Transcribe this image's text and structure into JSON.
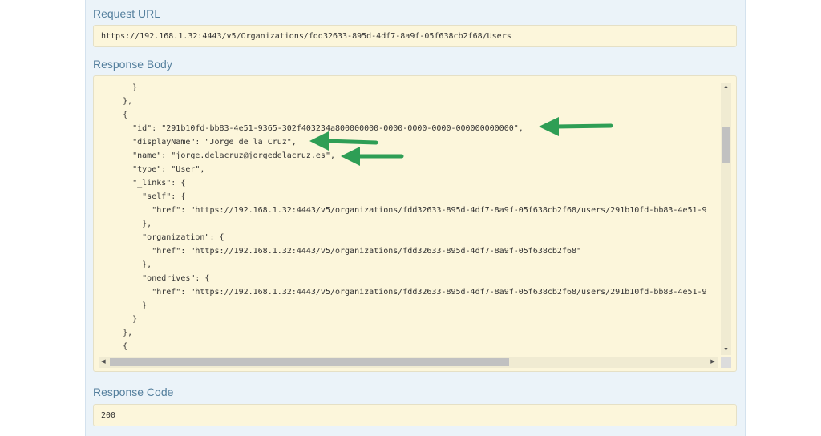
{
  "request_url": {
    "title": "Request URL",
    "value": "https://192.168.1.32:4443/v5/Organizations/fdd32633-895d-4df7-8a9f-05f638cb2f68/Users"
  },
  "response_body": {
    "title": "Response Body",
    "lines": [
      "      }",
      "    },",
      "    {",
      "      \"id\": \"291b10fd-bb83-4e51-9365-302f403234a800000000-0000-0000-0000-000000000000\",",
      "      \"displayName\": \"Jorge de la Cruz\",",
      "      \"name\": \"jorge.delacruz@jorgedelacruz.es\",",
      "      \"type\": \"User\",",
      "      \"_links\": {",
      "        \"self\": {",
      "          \"href\": \"https://192.168.1.32:4443/v5/organizations/fdd32633-895d-4df7-8a9f-05f638cb2f68/users/291b10fd-bb83-4e51-9",
      "        },",
      "        \"organization\": {",
      "          \"href\": \"https://192.168.1.32:4443/v5/organizations/fdd32633-895d-4df7-8a9f-05f638cb2f68\"",
      "        },",
      "        \"onedrives\": {",
      "          \"href\": \"https://192.168.1.32:4443/v5/organizations/fdd32633-895d-4df7-8a9f-05f638cb2f68/users/291b10fd-bb83-4e51-9",
      "        }",
      "      }",
      "    },",
      "    {"
    ]
  },
  "response_code": {
    "title": "Response Code",
    "value": "200"
  },
  "icons": {
    "scroll_up": "▲",
    "scroll_down": "▼",
    "scroll_left": "◀",
    "scroll_right": "▶"
  },
  "colors": {
    "section_title": "#547f9d",
    "code_background": "#fcf6db",
    "annotation_arrow": "#2e9e55"
  }
}
